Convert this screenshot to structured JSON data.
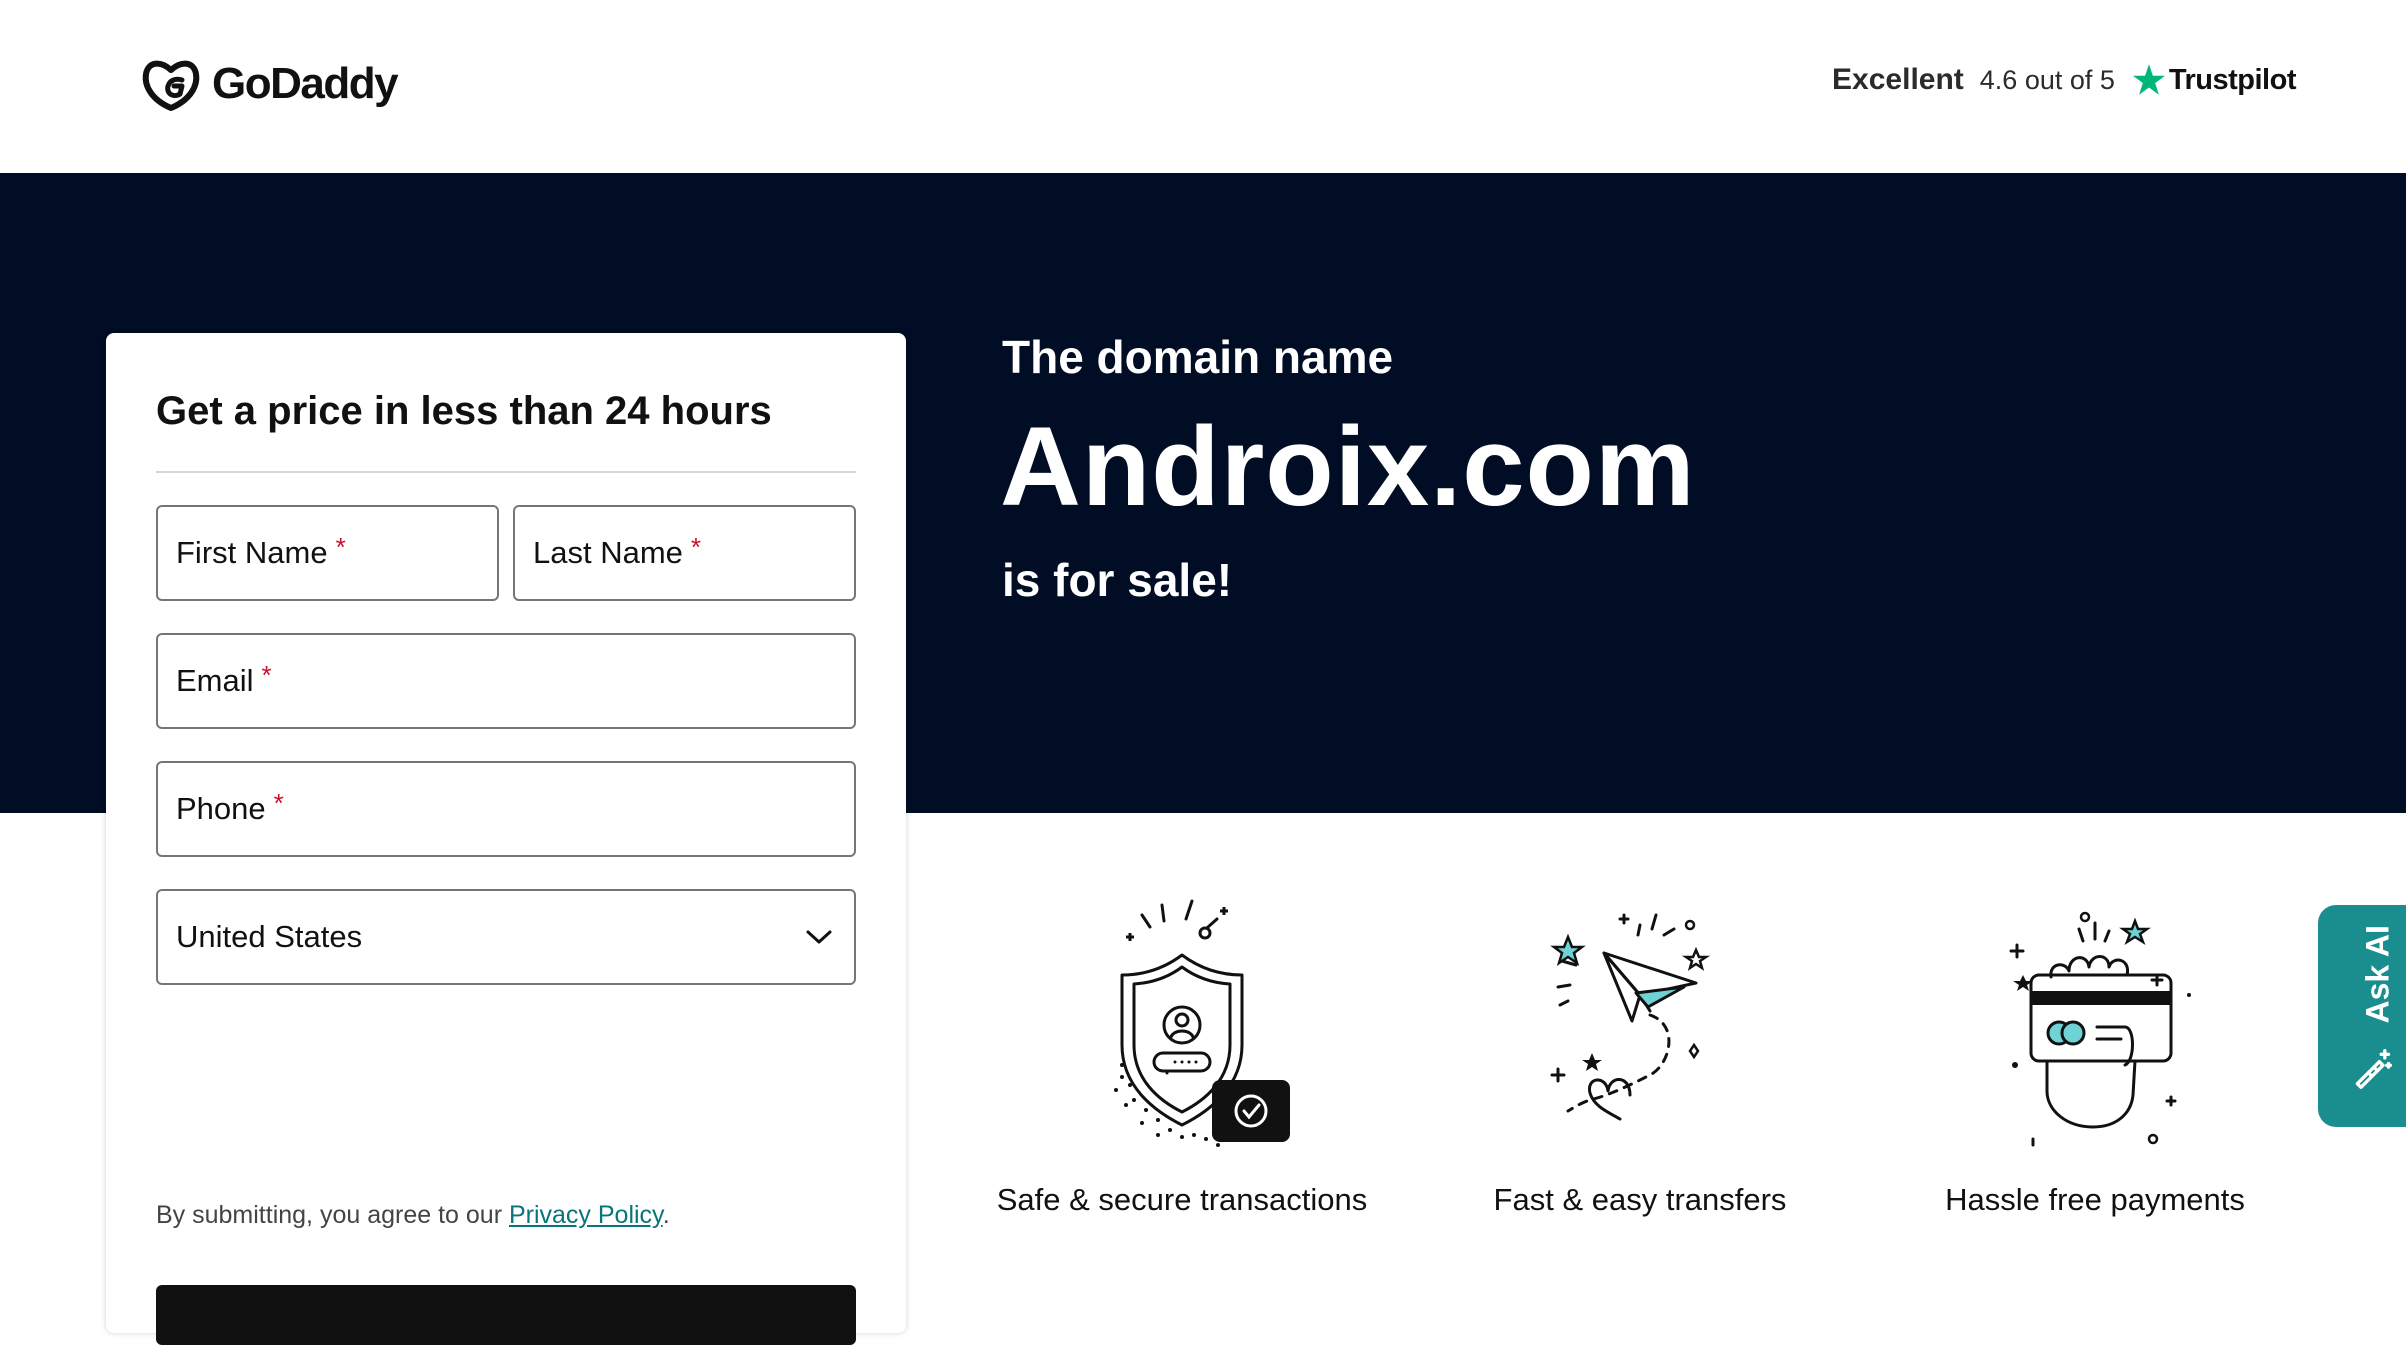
{
  "header": {
    "logo_text": "GoDaddy",
    "rating_label": "Excellent",
    "rating_score": "4.6 out of 5",
    "trustpilot_label": "Trustpilot"
  },
  "hero": {
    "subtitle": "The domain name",
    "domain": "Androix.com",
    "tagline": "is for sale!"
  },
  "form": {
    "title": "Get a price in less than 24 hours",
    "first_name_label": "First Name",
    "last_name_label": "Last Name",
    "email_label": "Email",
    "phone_label": "Phone",
    "required_mark": "*",
    "country_value": "United States",
    "consent_prefix": "By submitting, you agree to our ",
    "privacy_link": "Privacy Policy",
    "consent_suffix": "."
  },
  "features": [
    {
      "title": "Safe & secure transactions",
      "icon": "shield-check-icon"
    },
    {
      "title": "Fast & easy transfers",
      "icon": "paper-plane-icon"
    },
    {
      "title": "Hassle free payments",
      "icon": "hand-card-icon"
    }
  ],
  "ask_ai": {
    "label": "Ask AI"
  },
  "colors": {
    "hero_bg": "#000d24",
    "accent_teal": "#1a8d8f",
    "trustpilot_green": "#00b67a",
    "required_red": "#c8102e",
    "link_teal": "#09757a"
  }
}
